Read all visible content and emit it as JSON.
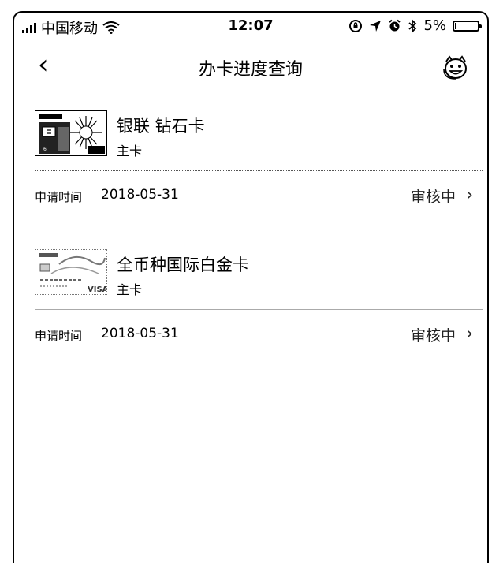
{
  "status_bar": {
    "carrier": "中国移动",
    "time": "12:07",
    "battery_percent": "5%",
    "battery_level": 0.05,
    "icons": [
      "signal-icon",
      "wifi-icon",
      "orientation-lock-icon",
      "location-icon",
      "alarm-icon",
      "bluetooth-icon",
      "battery-icon"
    ]
  },
  "nav": {
    "title": "办卡进度查询",
    "back_icon": "back-chevron-icon",
    "service_icon": "customer-service-icon"
  },
  "cards": [
    {
      "name": "银联 钻石卡",
      "type": "主卡",
      "apply_label": "申请时间",
      "apply_date": "2018-05-31",
      "status": "审核中",
      "chevron": "›"
    },
    {
      "name": "全币种国际白金卡",
      "type": "主卡",
      "apply_label": "申请时间",
      "apply_date": "2018-05-31",
      "status": "审核中",
      "chevron": "›",
      "card_brand": "VISA"
    }
  ]
}
